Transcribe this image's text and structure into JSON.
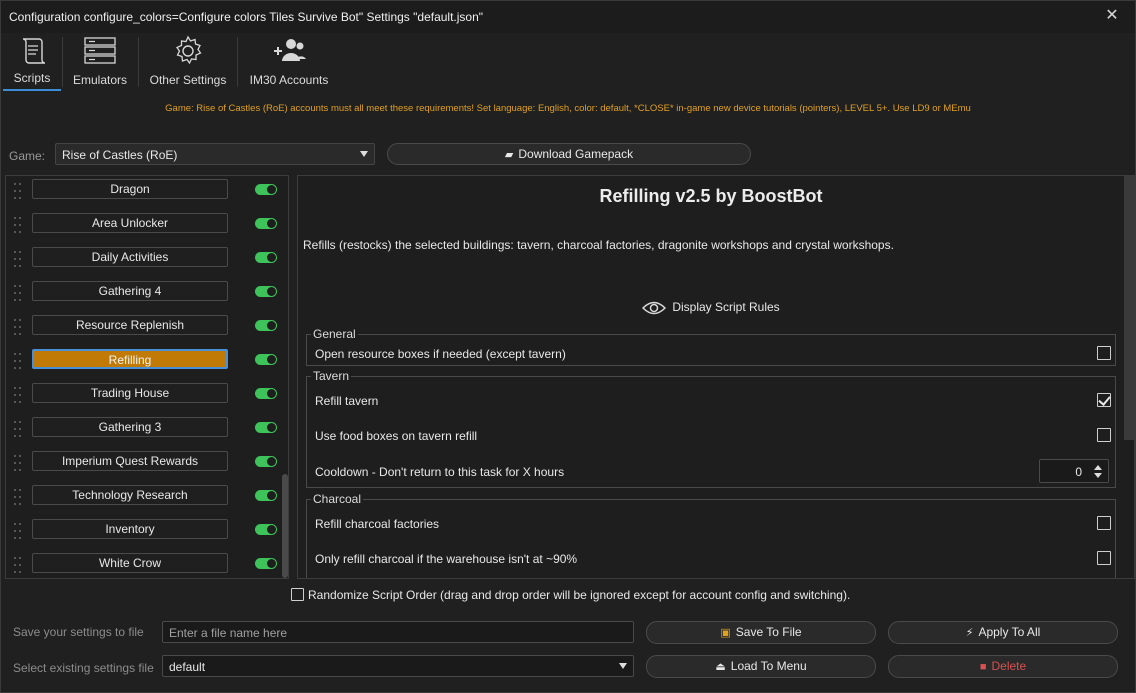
{
  "window": {
    "title": "Configuration configure_colors=Configure colors Tiles Survive Bot\" Settings \"default.json\"",
    "close_glyph": "✕"
  },
  "tabs": [
    {
      "label": "Scripts",
      "icon": "scroll-icon",
      "active": true
    },
    {
      "label": "Emulators",
      "icon": "server-icon",
      "active": false
    },
    {
      "label": "Other Settings",
      "icon": "gear-icon",
      "active": false
    },
    {
      "label": "IM30 Accounts",
      "icon": "add-user-icon",
      "active": false
    }
  ],
  "notice": "Game: Rise of Castles (RoE) accounts must all meet these requirements! Set language: English, color: default, *CLOSE* in-game new device tutorials (pointers), LEVEL 5+. Use LD9 or MEmu",
  "game": {
    "label": "Game:",
    "selected": "Rise of Castles (RoE)",
    "download_button": "Download Gamepack"
  },
  "scripts": [
    {
      "name": "Dragon",
      "enabled": true,
      "selected": false
    },
    {
      "name": "Area Unlocker",
      "enabled": true,
      "selected": false
    },
    {
      "name": "Daily Activities",
      "enabled": true,
      "selected": false
    },
    {
      "name": "Gathering 4",
      "enabled": true,
      "selected": false
    },
    {
      "name": "Resource Replenish",
      "enabled": true,
      "selected": false
    },
    {
      "name": "Refilling",
      "enabled": true,
      "selected": true
    },
    {
      "name": "Trading House",
      "enabled": true,
      "selected": false
    },
    {
      "name": "Gathering 3",
      "enabled": true,
      "selected": false
    },
    {
      "name": "Imperium Quest Rewards",
      "enabled": true,
      "selected": false
    },
    {
      "name": "Technology Research",
      "enabled": true,
      "selected": false
    },
    {
      "name": "Inventory",
      "enabled": true,
      "selected": false
    },
    {
      "name": "White Crow",
      "enabled": true,
      "selected": false
    }
  ],
  "detail": {
    "title": "Refilling v2.5 by BoostBot",
    "description": "Refills (restocks) the selected buildings: tavern, charcoal factories, dragonite workshops and crystal workshops.",
    "rules_link": "Display Script Rules",
    "groups": {
      "general": {
        "title": "General",
        "options": [
          {
            "label": "Open resource boxes if needed (except tavern)",
            "checked": false
          }
        ]
      },
      "tavern": {
        "title": "Tavern",
        "options": [
          {
            "label": "Refill tavern",
            "checked": true
          },
          {
            "label": "Use food boxes on tavern refill",
            "checked": false
          }
        ],
        "cooldown_label": "Cooldown - Don't return to this task for X hours",
        "cooldown_value": "0"
      },
      "charcoal": {
        "title": "Charcoal",
        "options": [
          {
            "label": "Refill charcoal factories",
            "checked": false
          },
          {
            "label": "Only refill charcoal if the warehouse isn't at ~90%",
            "checked": false
          }
        ]
      }
    }
  },
  "randomize": {
    "label": "Randomize Script Order (drag and drop order will be ignored except for account config and switching).",
    "checked": false
  },
  "footer": {
    "save_label": "Save your settings to file",
    "save_placeholder": "Enter a file name here",
    "save_button": "Save To File",
    "apply_button": "Apply To All",
    "select_label": "Select existing settings file",
    "select_value": "default",
    "load_button": "Load To Menu",
    "delete_button": "Delete"
  },
  "colors": {
    "accent": "#3b8ed6",
    "selected_script": "#c27a06",
    "toggle_on": "#3ec35a",
    "notice": "#e0a020",
    "delete": "#d85050"
  }
}
